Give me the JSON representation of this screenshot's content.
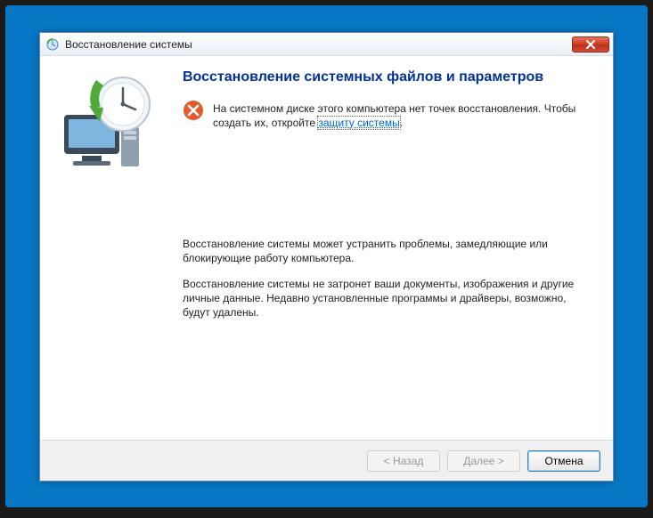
{
  "window": {
    "title": "Восстановление системы"
  },
  "content": {
    "heading": "Восстановление системных файлов и параметров",
    "alert_pre": "На системном диске этого компьютера нет точек восстановления. Чтобы создать их, откройте ",
    "alert_link": "защиту системы",
    "alert_post": ".",
    "para1": "Восстановление системы может устранить проблемы, замедляющие или блокирующие работу компьютера.",
    "para2": "Восстановление системы не затронет ваши документы, изображения и другие личные данные. Недавно установленные программы и драйверы, возможно, будут удалены."
  },
  "buttons": {
    "back": "< Назад",
    "next": "Далее >",
    "cancel": "Отмена"
  }
}
